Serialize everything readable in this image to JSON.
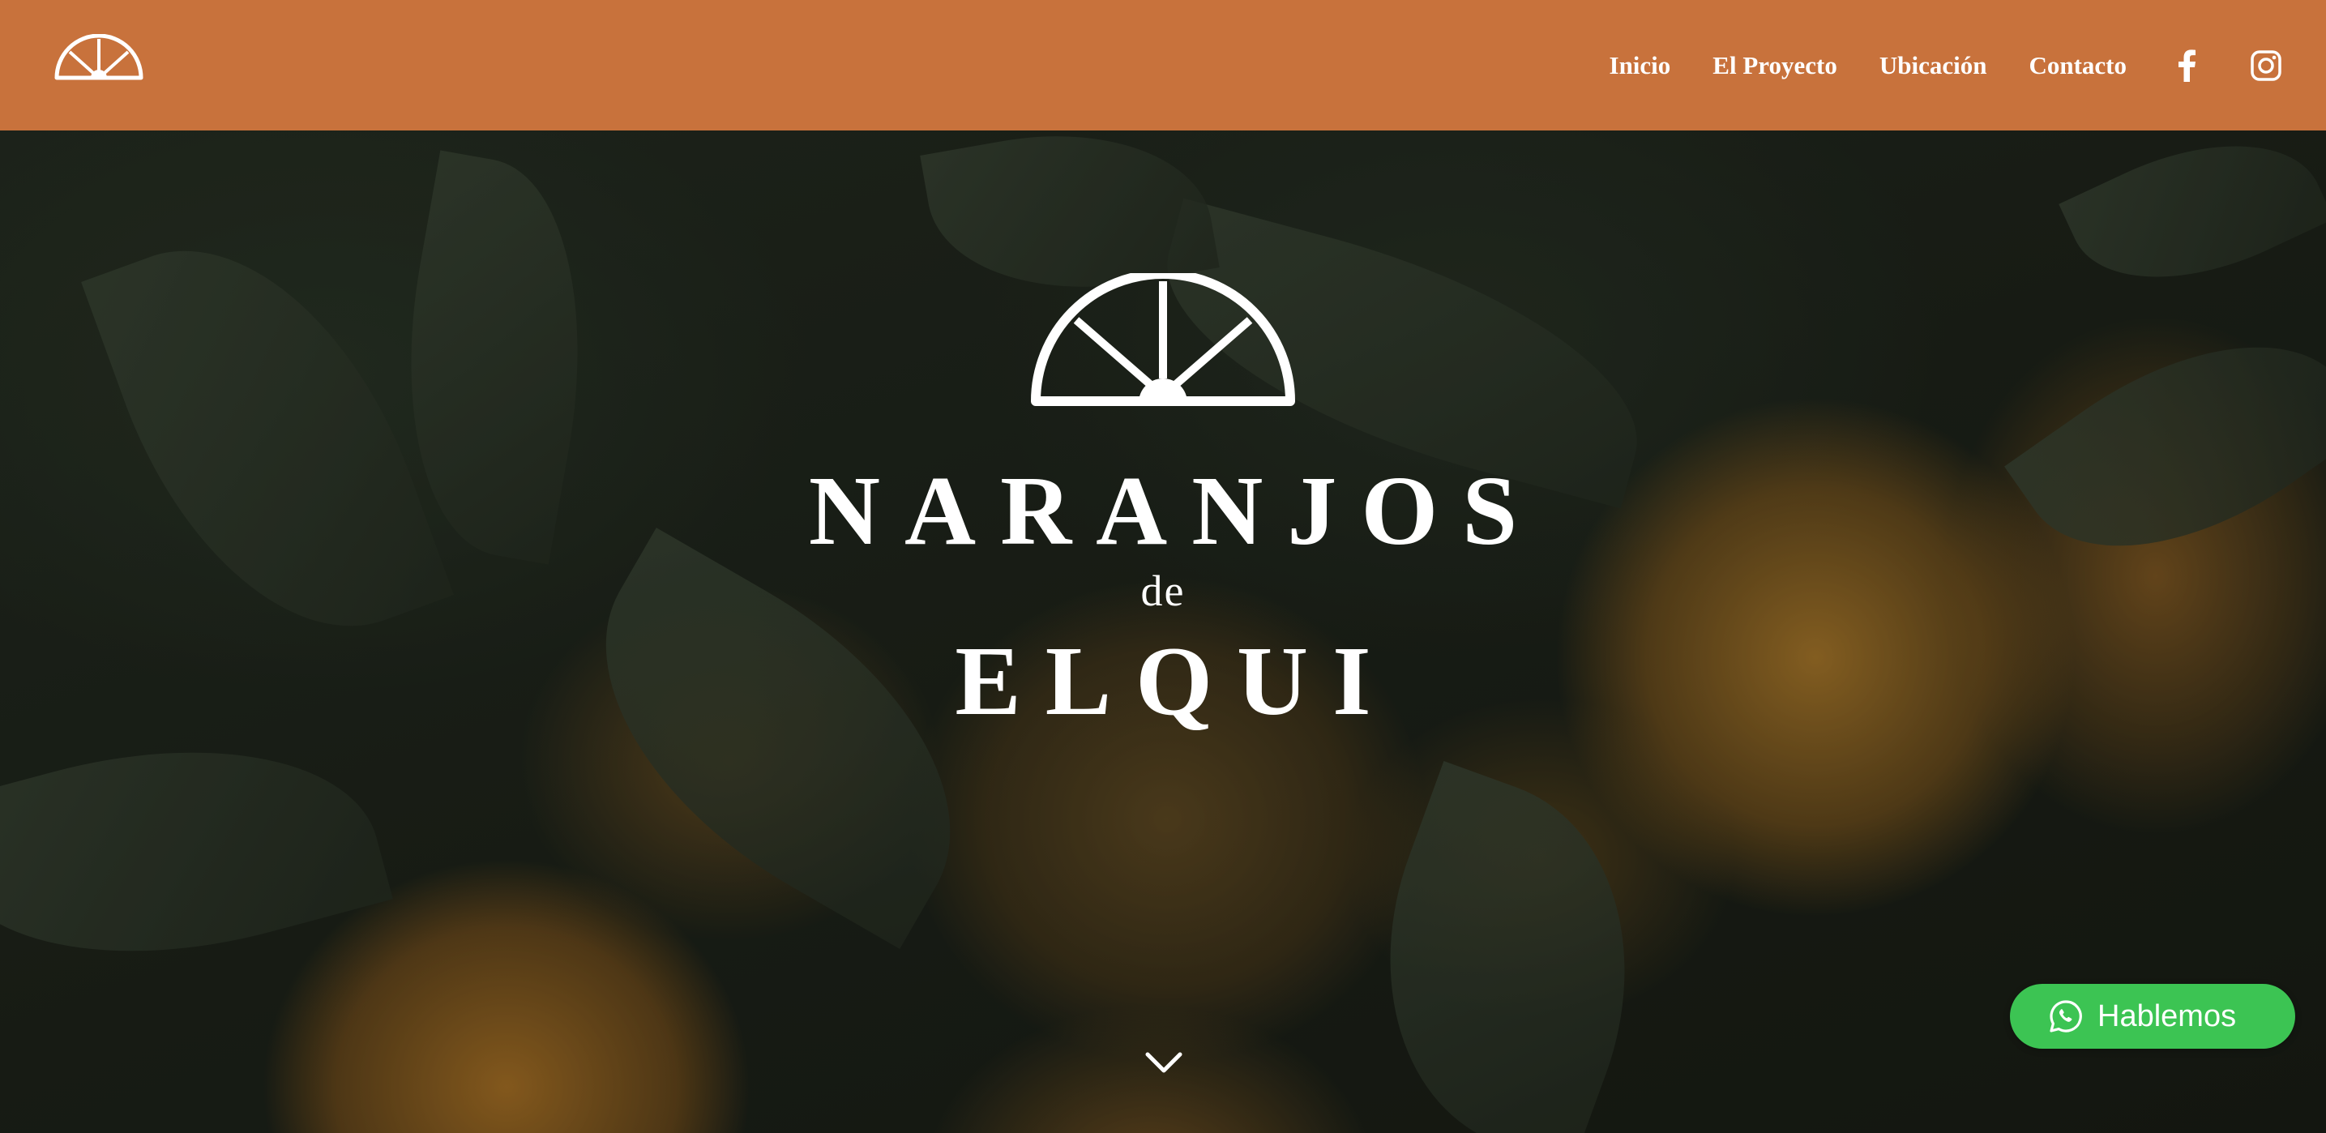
{
  "header": {
    "logo_icon": "half-orange-logo-icon",
    "nav": [
      {
        "label": "Inicio"
      },
      {
        "label": "El Proyecto"
      },
      {
        "label": "Ubicación"
      },
      {
        "label": "Contacto"
      }
    ],
    "social": [
      "facebook-icon",
      "instagram-icon"
    ],
    "background_color": "#c8723c"
  },
  "hero": {
    "brand_line1": "NARANJOS",
    "brand_line2": "de",
    "brand_line3": "ELQUI",
    "emblem_icon": "half-orange-emblem-icon",
    "scroll_icon": "chevron-down-icon"
  },
  "whatsapp_button": {
    "label": "Hablemos",
    "icon": "whatsapp-icon",
    "color": "#3cc453"
  }
}
